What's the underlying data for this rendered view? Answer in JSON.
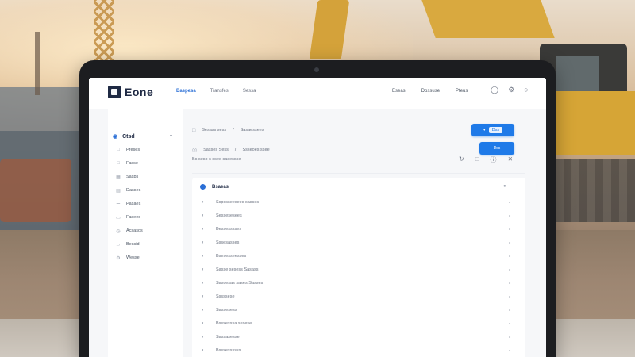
{
  "app": {
    "logo_text": "Eone"
  },
  "nav": {
    "left": [
      "Baspesa",
      "Transfes",
      "Sessa"
    ],
    "active_index": 0,
    "right": [
      "Eseas",
      "Dbssuse",
      "Pteus"
    ],
    "icons": [
      "help-icon",
      "settings-icon",
      "user-icon"
    ]
  },
  "sidebar": {
    "header": "Ctsd",
    "items": [
      {
        "label": "Preses",
        "icon": "file-icon"
      },
      {
        "label": "Fasse",
        "icon": "folder-icon"
      },
      {
        "label": "Sasps",
        "icon": "grid-icon"
      },
      {
        "label": "Dasses",
        "icon": "chart-icon"
      },
      {
        "label": "Pasaes",
        "icon": "list-icon"
      },
      {
        "label": "Faseed",
        "icon": "doc-icon"
      },
      {
        "label": "Acsasds",
        "icon": "clock-icon"
      },
      {
        "label": "Bessid",
        "icon": "tag-icon"
      },
      {
        "label": "Wesse",
        "icon": "gear-icon"
      }
    ]
  },
  "main": {
    "path_row_1": {
      "text_a": "Sesass sess",
      "text_b": "Sasaessees",
      "button": "Dss"
    },
    "path_row_2": {
      "text_a": "Sasses Sess",
      "text_b": "Ssseoes ssee",
      "button": "Dss"
    },
    "filter": {
      "text": "Bs seso s ssee sasessse"
    },
    "tools": [
      "refresh-icon",
      "folder-icon",
      "info-icon",
      "close-icon"
    ],
    "list_header": "Bsaeas",
    "rows": [
      "Sspssseesees sasses",
      "Sessesesees",
      "Bessesssses",
      "Sssesasses",
      "Bsesesseesses",
      "Sasse sesess Sasass",
      "Sascesas sases Sasses",
      "Sssssese",
      "Sassesess",
      "Bsssesssa sesese",
      "Sassasesse",
      "Bsssessssss"
    ]
  }
}
